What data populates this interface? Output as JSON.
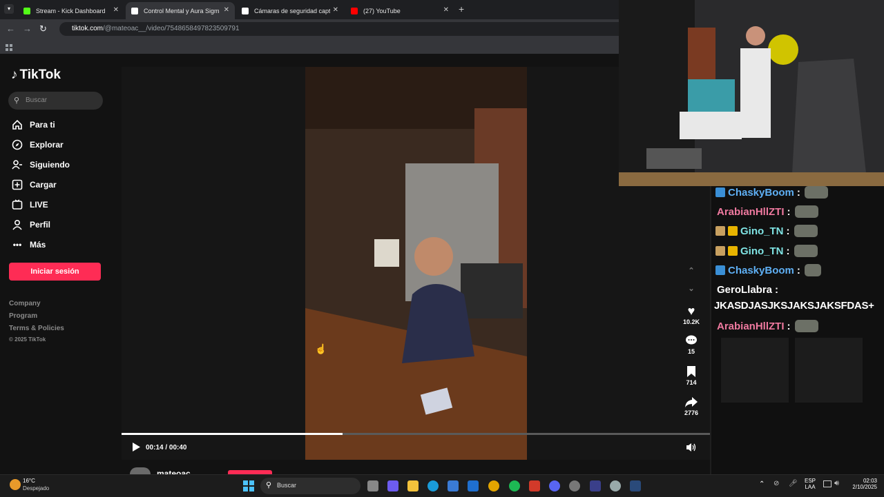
{
  "browser": {
    "tabs": [
      {
        "title": "Stream - Kick Dashboard",
        "active": false,
        "favicon_color": "#53fc18"
      },
      {
        "title": "Control Mental y Aura Sigma: L",
        "active": true,
        "favicon_color": "#ffffff"
      },
      {
        "title": "Cámaras de seguridad captaro",
        "active": false,
        "favicon_color": "#ffffff"
      },
      {
        "title": "(27) YouTube",
        "active": false,
        "favicon_color": "#ff0000"
      }
    ],
    "url_host": "tiktok.com",
    "url_path": "/@mateoac__/video/7548658497823509791"
  },
  "tiktok": {
    "brand": "TikTok",
    "search_placeholder": "Buscar",
    "nav": [
      {
        "label": "Para ti",
        "icon": "home-icon"
      },
      {
        "label": "Explorar",
        "icon": "compass-icon"
      },
      {
        "label": "Siguiendo",
        "icon": "following-icon"
      },
      {
        "label": "Cargar",
        "icon": "upload-icon"
      },
      {
        "label": "LIVE",
        "icon": "live-icon"
      },
      {
        "label": "Perfil",
        "icon": "profile-icon"
      },
      {
        "label": "Más",
        "icon": "more-icon"
      }
    ],
    "login_label": "Iniciar sesión",
    "footer": [
      "Company",
      "Program",
      "Terms & Policies"
    ],
    "copyright": "© 2025 TikTok",
    "player": {
      "time": "00:14 / 00:40",
      "progress": 0.375
    },
    "actions": {
      "likes": "10.2K",
      "comments": "15",
      "saves": "714",
      "shares": "2776"
    },
    "author": "mateoac"
  },
  "chat": [
    {
      "user": "ChaskyBoom",
      "color": "#5fb0f5",
      "badges": [
        "blue"
      ],
      "text": ":"
    },
    {
      "user": "ArabianHllZTI",
      "color": "#f07aa0",
      "badges": [],
      "text": ":"
    },
    {
      "user": "Gino_TN",
      "color": "#7fe3e3",
      "badges": [
        "tan",
        "gold"
      ],
      "text": ":"
    },
    {
      "user": "Gino_TN",
      "color": "#7fe3e3",
      "badges": [
        "tan",
        "gold"
      ],
      "text": ":"
    },
    {
      "user": "ChaskyBoom",
      "color": "#5fb0f5",
      "badges": [
        "blue"
      ],
      "text": ":"
    },
    {
      "user": "GeroLlabra",
      "color": "#ffffff",
      "badges": [],
      "text": ":"
    },
    {
      "user": "",
      "color": "#ffffff",
      "badges": [],
      "text": "JKASDJASJKSJAKSJAKSFDAS+"
    },
    {
      "user": "ArabianHllZTI",
      "color": "#f07aa0",
      "badges": [],
      "text": ":"
    }
  ],
  "taskbar": {
    "weather_temp": "16°C",
    "weather_desc": "Despejado",
    "search_label": "Buscar",
    "lang": "ESP",
    "lang_sub": "LAA",
    "time": "02:03",
    "date": "2/10/2025"
  }
}
